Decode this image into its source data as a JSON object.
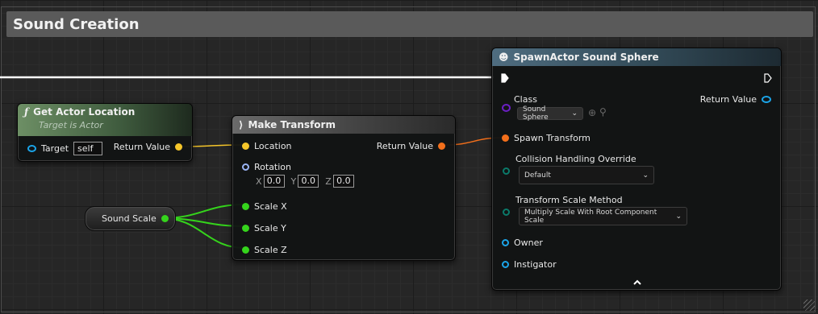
{
  "comment": {
    "title": "Sound Creation"
  },
  "colors": {
    "exec": "#ffffff",
    "vector": "#f6c62a",
    "transform": "#f36f1b",
    "float": "#35d41c",
    "object": "#1ba4e8",
    "class": "#6b1fc4",
    "rotator": "#9bb5f5",
    "enum": "#0a7a6a"
  },
  "get_actor_location": {
    "title": "Get Actor Location",
    "subtitle": "Target is Actor",
    "icon": "function-icon",
    "target_label": "Target",
    "target_value": "self",
    "return_label": "Return Value"
  },
  "make_transform": {
    "title": "Make Transform",
    "icon": "make-struct-icon",
    "location_label": "Location",
    "rotation_label": "Rotation",
    "rotation": {
      "x_label": "X",
      "x": "0.0",
      "y_label": "Y",
      "y": "0.0",
      "z_label": "Z",
      "z": "0.0"
    },
    "scale_x_label": "Scale X",
    "scale_y_label": "Scale Y",
    "scale_z_label": "Scale Z",
    "return_label": "Return Value"
  },
  "sound_scale": {
    "label": "Sound Scale"
  },
  "spawn_actor": {
    "title": "SpawnActor Sound Sphere",
    "icon": "spawn-actor-icon",
    "class_label": "Class",
    "class_value": "Sound Sphere",
    "return_label": "Return Value",
    "spawn_transform_label": "Spawn Transform",
    "collision_label": "Collision Handling Override",
    "collision_value": "Default",
    "scale_method_label": "Transform Scale Method",
    "scale_method_value": "Multiply Scale With Root Component Scale",
    "owner_label": "Owner",
    "instigator_label": "Instigator",
    "collapse_icon": "chevron-up-icon"
  }
}
